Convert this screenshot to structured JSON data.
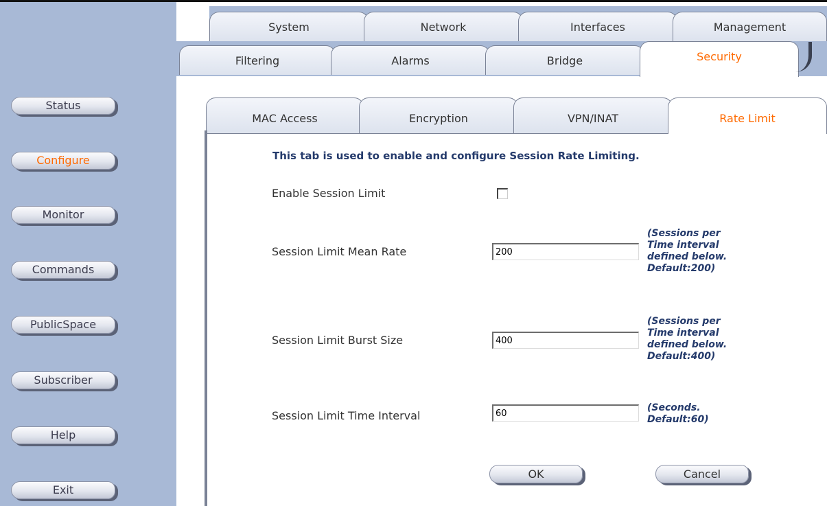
{
  "sidebar": {
    "items": [
      {
        "label": "Status"
      },
      {
        "label": "Configure",
        "active": true
      },
      {
        "label": "Monitor"
      },
      {
        "label": "Commands"
      },
      {
        "label": "PublicSpace"
      },
      {
        "label": "Subscriber"
      },
      {
        "label": "Help"
      },
      {
        "label": "Exit"
      }
    ]
  },
  "tabs_row1": [
    "System",
    "Network",
    "Interfaces",
    "Management"
  ],
  "tabs_row2": [
    "Filtering",
    "Alarms",
    "Bridge",
    "Security"
  ],
  "tabs_row2_selected": "Security",
  "tabs_row3": [
    "MAC Access",
    "Encryption",
    "VPN/INAT",
    "Rate Limit"
  ],
  "tabs_row3_selected": "Rate Limit",
  "form": {
    "intro": "This tab is used to enable and configure Session Rate Limiting.",
    "enable_label": "Enable Session Limit",
    "enable_checked": false,
    "mean_rate_label": "Session Limit Mean Rate",
    "mean_rate_value": "200",
    "mean_rate_hint": "(Sessions per\nTime interval\ndefined below.\nDefault:200)",
    "burst_label": "Session Limit Burst Size",
    "burst_value": "400",
    "burst_hint": "(Sessions per\nTime interval\ndefined below.\nDefault:400)",
    "interval_label": "Session Limit Time Interval",
    "interval_value": "60",
    "interval_hint": "(Seconds.\nDefault:60)",
    "ok_label": "OK",
    "cancel_label": "Cancel"
  },
  "colors": {
    "sidebar_bg": "#a8b9d6",
    "accent": "#ff6a00",
    "hint_text": "#243a6b"
  }
}
